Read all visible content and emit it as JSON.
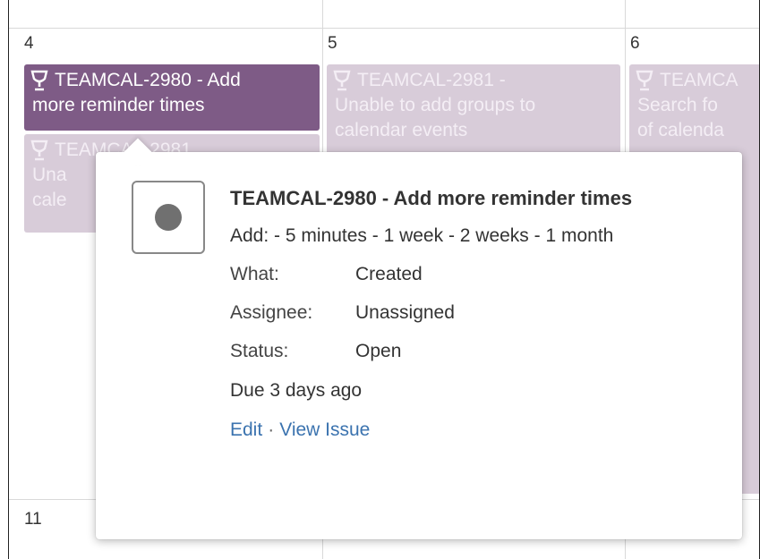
{
  "calendar": {
    "day_numbers": {
      "d4": "4",
      "d5": "5",
      "d6": "6",
      "d11": "11"
    },
    "events": [
      {
        "title": "TEAMCAL-2980 - Add",
        "line2": "more reminder times"
      },
      {
        "title": "TEAMCAL-2981 -",
        "line2": "Unable to add groups to",
        "line3": "calendar events"
      },
      {
        "title": "TEAMCA",
        "line2": "Search fo",
        "line3": "of calenda"
      },
      {
        "title": "TEAMCAL-2981",
        "line2": "Una",
        "line3": "cale"
      }
    ],
    "colors": {
      "active_event": "#7e5b86",
      "faded_event": "#d8ccd9",
      "grid": "#d9d9d9"
    }
  },
  "popup": {
    "title": "TEAMCAL-2980 - Add more reminder times",
    "description": "Add: - 5 minutes - 1 week - 2 weeks - 1 month",
    "fields": [
      {
        "label": "What:",
        "value": "Created"
      },
      {
        "label": "Assignee:",
        "value": "Unassigned"
      },
      {
        "label": "Status:",
        "value": "Open"
      }
    ],
    "due": "Due 3 days ago",
    "edit_link": "Edit",
    "separator": "·",
    "view_issue_link": "View Issue",
    "status_icon": "open-status-icon",
    "link_color": "#3b73af"
  }
}
